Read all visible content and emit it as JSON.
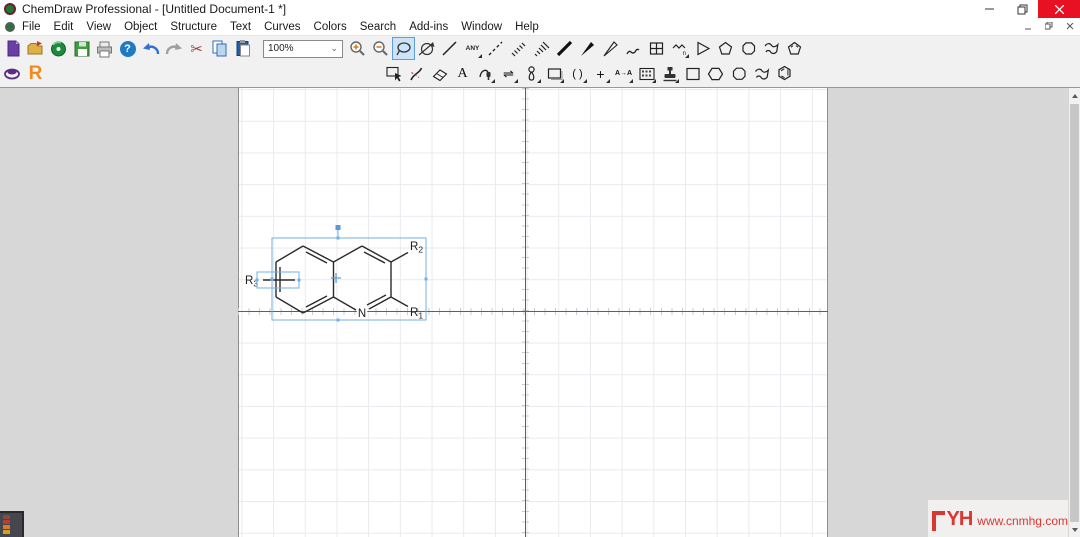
{
  "window": {
    "title": "ChemDraw Professional - [Untitled Document-1 *]"
  },
  "menu": {
    "items": [
      "File",
      "Edit",
      "View",
      "Object",
      "Structure",
      "Text",
      "Curves",
      "Colors",
      "Search",
      "Add-ins",
      "Window",
      "Help"
    ]
  },
  "toolbar": {
    "zoom_value": "100%",
    "labels": {
      "help": "?",
      "cut": "✂",
      "any_bond": "ANY",
      "poly_sub": "n",
      "text_tool": "A",
      "reaction_arrows": "⇌",
      "brackets": "( )",
      "plus": "+",
      "atom_map": "A→A",
      "r_logo": "R",
      "combo_chevron": "⌄"
    }
  },
  "molecule": {
    "n": "N",
    "r1_base": "R",
    "r1_sub": "1",
    "r2_base": "R",
    "r2_sub": "2",
    "r3_base": "R",
    "r3_sub": "3"
  },
  "watermark": {
    "logo": "YH",
    "url": "www.cnmhg.com"
  },
  "colors": {
    "selection_blue": "#74afe6",
    "close_red": "#e81123",
    "watermark_red": "#d93732",
    "bond": "#2b2b2b"
  }
}
